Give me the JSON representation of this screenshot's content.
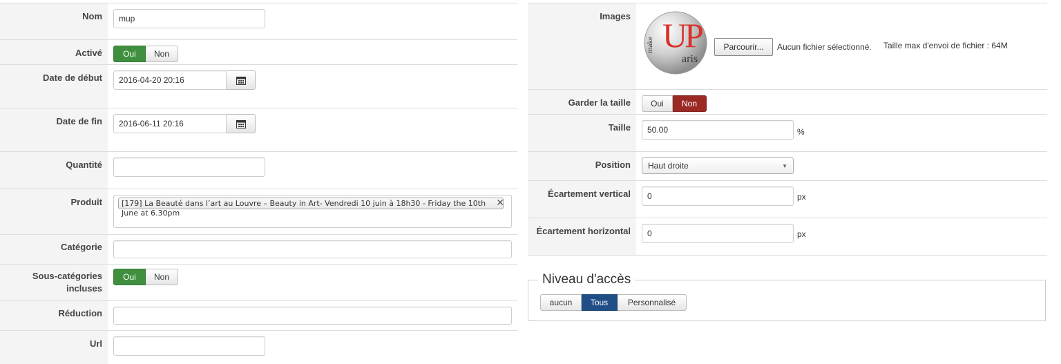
{
  "left": {
    "nom": {
      "label": "Nom",
      "value": "mup"
    },
    "active": {
      "label": "Activé",
      "yes": "Oui",
      "no": "Non"
    },
    "date_debut": {
      "label": "Date de début",
      "value": "2016-04-20 20:16"
    },
    "date_fin": {
      "label": "Date de fin",
      "value": "2016-06-11 20:16"
    },
    "quantite": {
      "label": "Quantité",
      "value": ""
    },
    "produit": {
      "label": "Produit",
      "tag": "[179] La Beauté dans l’art au Louvre – Beauty in Art- Vendredi 10 juin à 18h30 - Friday the 10th June at 6.30pm"
    },
    "categorie": {
      "label": "Catégorie",
      "value": ""
    },
    "sous_categories": {
      "label": "Sous-catégories incluses",
      "yes": "Oui",
      "no": "Non"
    },
    "reduction": {
      "label": "Réduction",
      "value": ""
    },
    "url": {
      "label": "Url",
      "value": ""
    }
  },
  "right": {
    "images": {
      "label": "Images",
      "browse": "Parcourir...",
      "no_file": "Aucun fichier sélectionné.",
      "max_size": "Taille max d'envoi de fichier : 64M",
      "logo_letters_big": "UP",
      "logo_letters_side": "make",
      "logo_letters_small": "aris"
    },
    "garder_taille": {
      "label": "Garder la taille",
      "yes": "Oui",
      "no": "Non"
    },
    "taille": {
      "label": "Taille",
      "value": "50.00",
      "unit": "%"
    },
    "position": {
      "label": "Position",
      "selected": "Haut droite"
    },
    "ecart_vertical": {
      "label": "Écartement vertical",
      "value": "0",
      "unit": "px"
    },
    "ecart_horizontal": {
      "label": "Écartement horizontal",
      "value": "0",
      "unit": "px"
    }
  },
  "access": {
    "legend": "Niveau d'accès",
    "options": [
      "aucun",
      "Tous",
      "Personnalisé"
    ],
    "selected": "Tous"
  },
  "colors": {
    "active_green": "#3f8f3f",
    "active_red": "#9b2a25",
    "active_blue": "#1f4f86",
    "logo_red": "#d8322b"
  }
}
